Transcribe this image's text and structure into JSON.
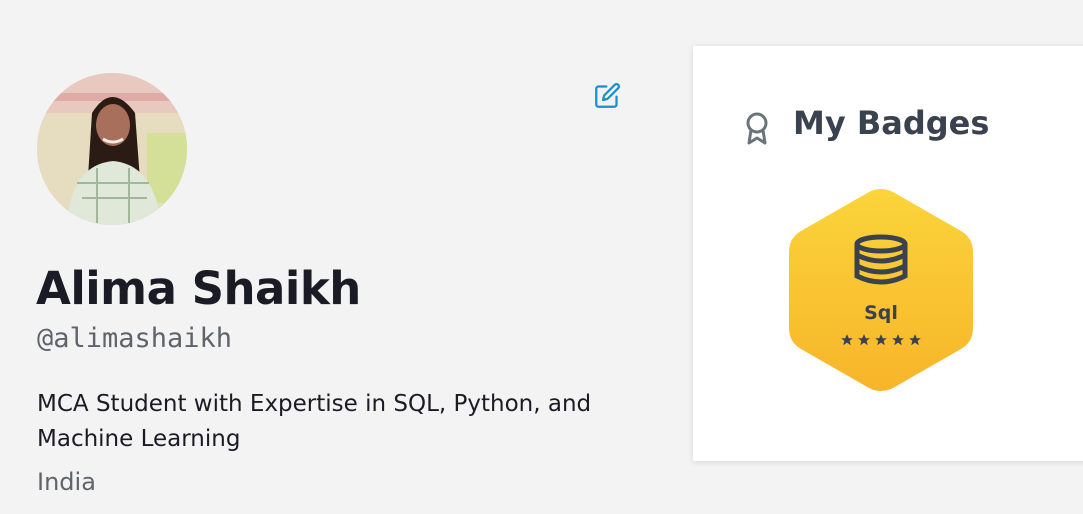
{
  "profile": {
    "name": "Alima Shaikh",
    "handle": "@alimashaikh",
    "bio": "MCA Student with Expertise in SQL, Python, and Machine Learning",
    "location": "India"
  },
  "icons": {
    "edit": "edit-icon",
    "badges_title": "award-ribbon-icon",
    "badge": "database-icon",
    "star": "star-icon"
  },
  "badges": {
    "title": "My Badges",
    "items": [
      {
        "label": "Sql",
        "stars": 5
      }
    ]
  },
  "colors": {
    "accent": "#1a8fc8",
    "badge_gold_top": "#fbd43a",
    "badge_gold_bottom": "#f7b52a",
    "text_dark": "#1b1b25",
    "text_muted": "#5f646b",
    "heading": "#39424e"
  }
}
